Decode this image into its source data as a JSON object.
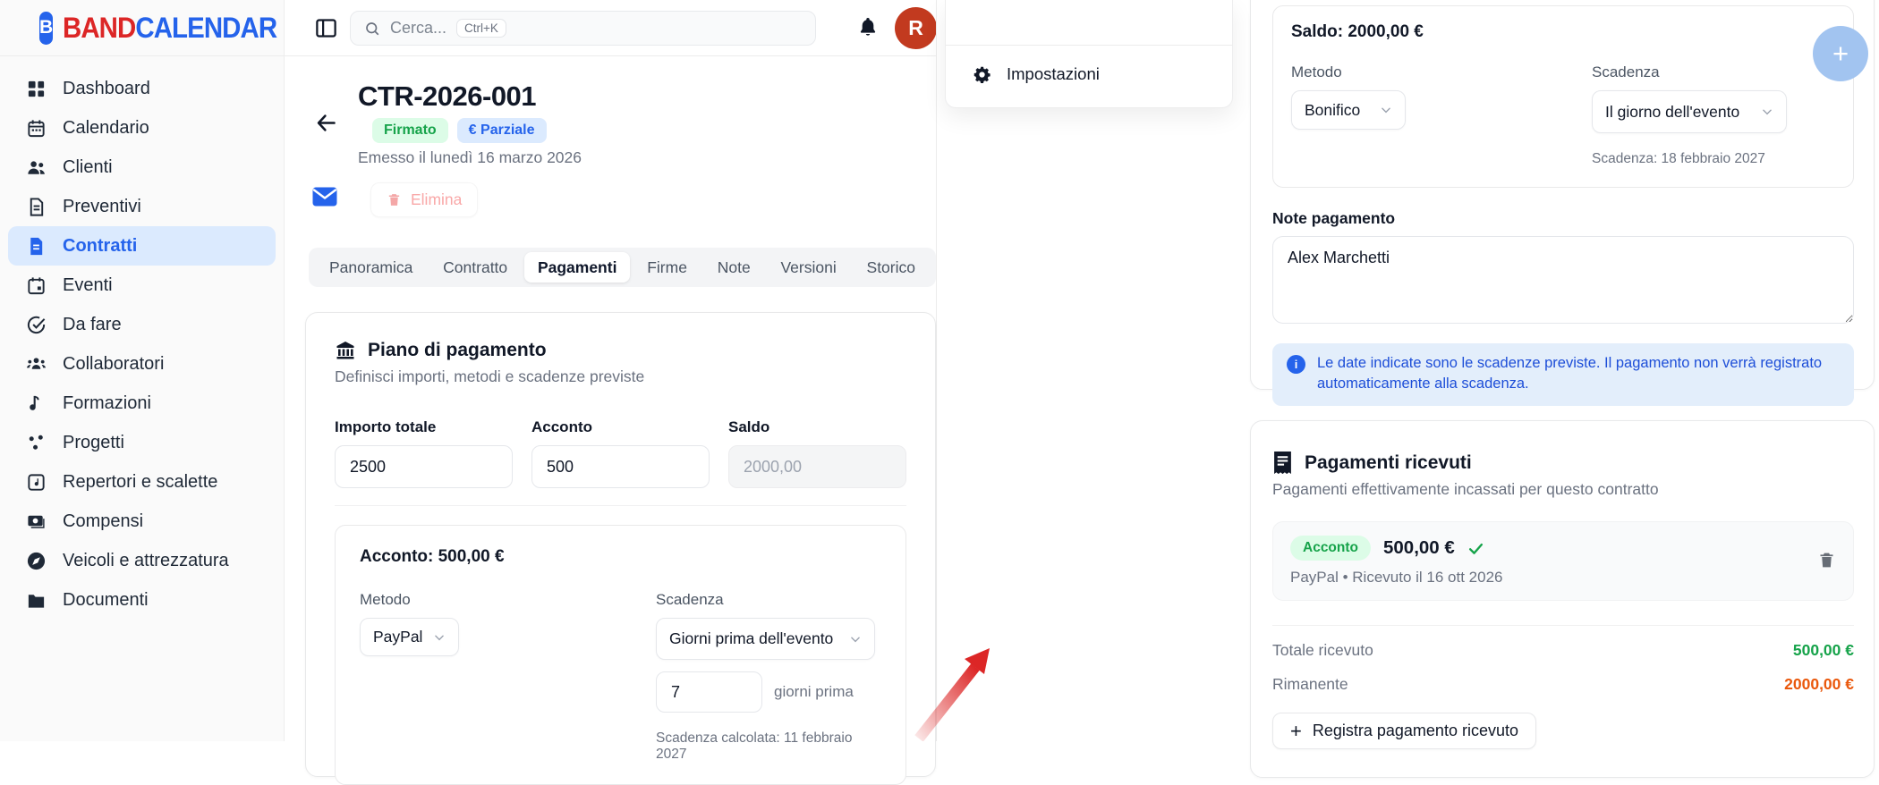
{
  "brand": {
    "logo_letter": "B",
    "name_band": "BAND",
    "name_calendar": "CALENDAR"
  },
  "topbar": {
    "search_placeholder": "Cerca...",
    "search_shortcut": "Ctrl+K",
    "avatar_initial": "R"
  },
  "sidebar": {
    "items": [
      {
        "label": "Dashboard",
        "icon": "dashboard",
        "active": false
      },
      {
        "label": "Calendario",
        "icon": "calendar",
        "active": false
      },
      {
        "label": "Clienti",
        "icon": "users",
        "active": false
      },
      {
        "label": "Preventivi",
        "icon": "file-text",
        "active": false
      },
      {
        "label": "Contratti",
        "icon": "file",
        "active": true
      },
      {
        "label": "Eventi",
        "icon": "calendar-event",
        "active": false
      },
      {
        "label": "Da fare",
        "icon": "check-circle",
        "active": false
      },
      {
        "label": "Collaboratori",
        "icon": "users-3",
        "active": false
      },
      {
        "label": "Formazioni",
        "icon": "music",
        "active": false
      },
      {
        "label": "Progetti",
        "icon": "dots",
        "active": false
      },
      {
        "label": "Repertori e scalette",
        "icon": "playlist",
        "active": false
      },
      {
        "label": "Compensi",
        "icon": "banknote",
        "active": false
      },
      {
        "label": "Veicoli e attrezzatura",
        "icon": "compass",
        "active": false
      },
      {
        "label": "Documenti",
        "icon": "folder",
        "active": false
      }
    ]
  },
  "contract_header": {
    "title": "CTR-2026-001",
    "badge_signed": "Firmato",
    "badge_partial": "€ Parziale",
    "issued": "Emesso il lunedì 16 marzo 2026",
    "delete_label": "Elimina"
  },
  "tabs": [
    {
      "label": "Panoramica",
      "active": false
    },
    {
      "label": "Contratto",
      "active": false
    },
    {
      "label": "Pagamenti",
      "active": true
    },
    {
      "label": "Firme",
      "active": false
    },
    {
      "label": "Note",
      "active": false
    },
    {
      "label": "Versioni",
      "active": false
    },
    {
      "label": "Storico",
      "active": false
    }
  ],
  "menu": {
    "settings_label": "Impostazioni"
  },
  "payment_plan": {
    "title": "Piano di pagamento",
    "subtitle": "Definisci importi, metodi e scadenze previste",
    "total_label": "Importo totale",
    "total_value": "2500",
    "deposit_label": "Acconto",
    "deposit_value": "500",
    "balance_label": "Saldo",
    "balance_value": "2000,00",
    "deposit_section": {
      "title": "Acconto: 500,00 €",
      "method_label": "Metodo",
      "method_value": "PayPal",
      "due_label": "Scadenza",
      "due_value": "Giorni prima dell'evento",
      "days_value": "7",
      "days_suffix": "giorni prima",
      "calculated": "Scadenza calcolata: 11 febbraio 2027"
    },
    "balance_section": {
      "title": "Saldo: 2000,00 €",
      "method_label": "Metodo",
      "method_value": "Bonifico",
      "due_label": "Scadenza",
      "due_value": "Il giorno dell'evento",
      "due_date": "Scadenza: 18 febbraio 2027"
    },
    "notes_label": "Note pagamento",
    "notes_value": "Alex Marchetti",
    "info_text": "Le date indicate sono le scadenze previste. Il pagamento non verrà registrato automaticamente alla scadenza."
  },
  "received": {
    "title": "Pagamenti ricevuti",
    "subtitle": "Pagamenti effettivamente incassati per questo contratto",
    "payment": {
      "badge": "Acconto",
      "amount": "500,00 €",
      "meta": "PayPal • Ricevuto il 16 ott 2026"
    },
    "total_label": "Totale ricevuto",
    "total_value": "500,00 €",
    "remaining_label": "Rimanente",
    "remaining_value": "2000,00 €",
    "register_label": "Registra pagamento ricevuto"
  },
  "colors": {
    "accent_blue": "#2563eb",
    "brand_red": "#dc2626",
    "success_green": "#16a34a",
    "warning_orange": "#ea580c",
    "avatar_bg": "#c23a1f",
    "active_nav_bg": "#dbeafe",
    "info_bg": "#e3eefb",
    "fab_bg": "#a2c4f0"
  }
}
